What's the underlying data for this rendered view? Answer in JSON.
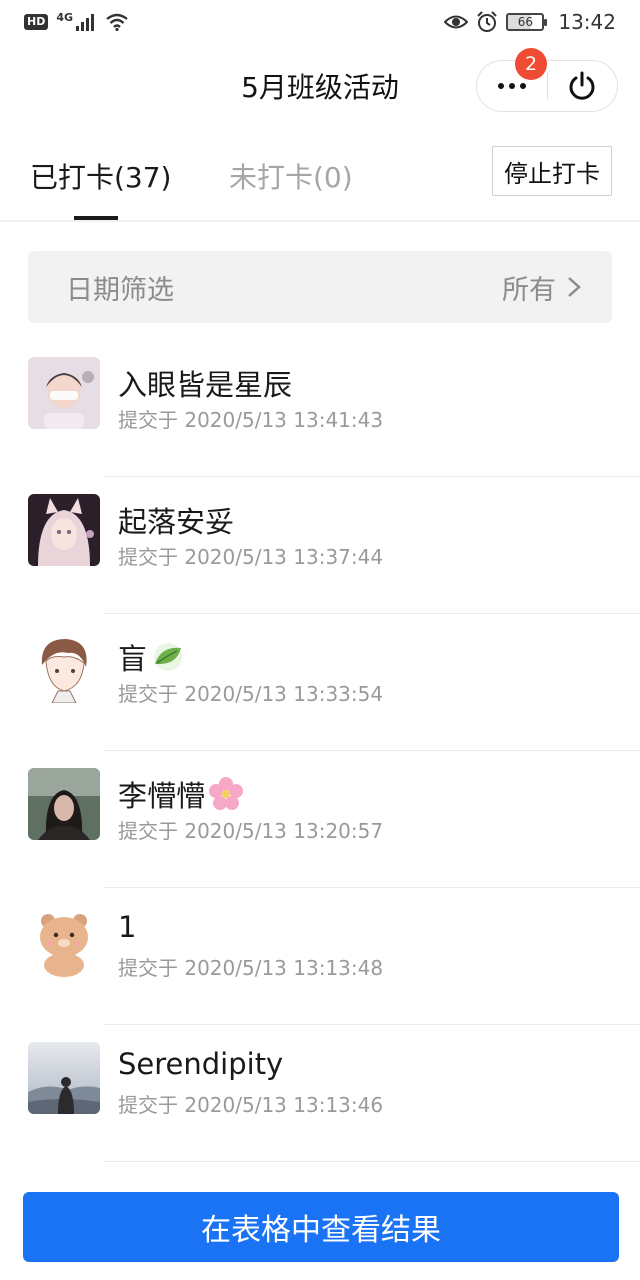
{
  "status_bar": {
    "hd": "HD",
    "network": "4G",
    "battery": "66",
    "time": "13:42"
  },
  "header": {
    "title": "5月班级活动",
    "more_badge": "2",
    "icons": [
      "more-dots-icon",
      "power-icon"
    ]
  },
  "tabs": [
    {
      "label": "已打卡(37)",
      "active": true
    },
    {
      "label": "未打卡(0)",
      "active": false
    }
  ],
  "stop_button": "停止打卡",
  "filter": {
    "label": "日期筛选",
    "value": "所有"
  },
  "entries": [
    {
      "name": "入眼皆是星辰",
      "time": "提交于 2020/5/13 13:41:43",
      "avatar": "girl-with-mask"
    },
    {
      "name": "起落安妥",
      "time": "提交于 2020/5/13 13:37:44",
      "avatar": "anime-girl-pink"
    },
    {
      "name": "盲",
      "time": "提交于 2020/5/13 13:33:54",
      "avatar": "anime-boy-sketch",
      "emoji": "🍃"
    },
    {
      "name": "李懵懵",
      "time": "提交于 2020/5/13 13:20:57",
      "avatar": "girl-dark-photo",
      "emoji": "🌸"
    },
    {
      "name": "1",
      "time": "提交于 2020/5/13 13:13:48",
      "avatar": "cartoon-bear"
    },
    {
      "name": "Serendipity",
      "time": "提交于 2020/5/13 13:13:46",
      "avatar": "misty-landscape"
    }
  ],
  "bottom_button": "在表格中查看结果",
  "colors": {
    "primary": "#1a73f5",
    "badge": "#f04b33",
    "muted_text": "#9a9a9a"
  }
}
